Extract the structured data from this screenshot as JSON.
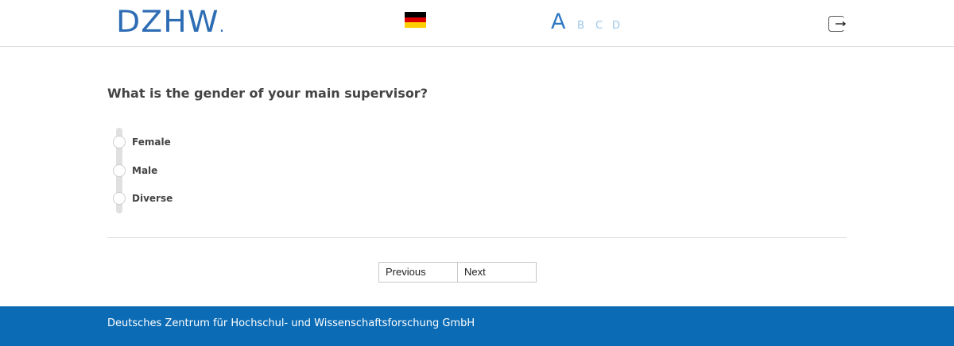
{
  "header": {
    "logo_text": "DZHW",
    "logo_dot": ".",
    "language_flag": "germany-flag-icon",
    "font_sizes": [
      "A",
      "B",
      "C",
      "D"
    ],
    "exit_icon": "exit-icon"
  },
  "question": {
    "text": "What is the gender of your main supervisor?",
    "options": [
      {
        "label": "Female",
        "selected": false
      },
      {
        "label": "Male",
        "selected": false
      },
      {
        "label": "Diverse",
        "selected": false
      }
    ]
  },
  "navigation": {
    "previous_label": "Previous",
    "next_label": "Next"
  },
  "footer": {
    "text": "Deutsches Zentrum für Hochschul- und Wissenschaftsforschung GmbH"
  },
  "colors": {
    "brand_blue": "#0b6bb5",
    "logo_blue": "#2e6db4",
    "font_size_active": "#2f78c3",
    "font_size_inactive": "#9cc6e6"
  }
}
